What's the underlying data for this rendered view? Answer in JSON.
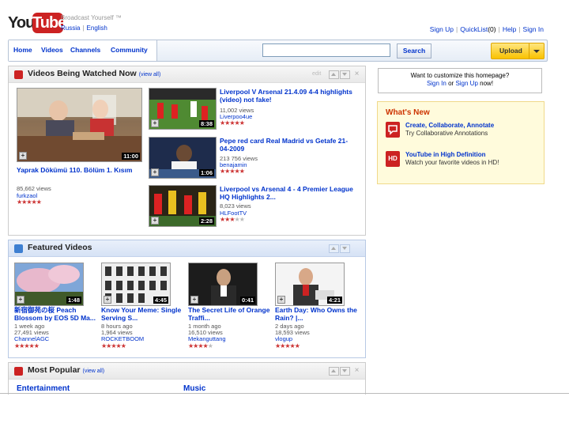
{
  "header": {
    "logo_you": "You",
    "logo_tube": "Tube",
    "tagline": "Broadcast Yourself ™",
    "region": "Russia",
    "language": "English",
    "links": [
      "Sign Up",
      "QuickList",
      "(0)",
      "Help",
      "Sign In"
    ]
  },
  "nav": {
    "tabs": [
      "Home",
      "Videos",
      "Channels",
      "Community"
    ],
    "search_value": "",
    "search_button": "Search",
    "upload_button": "Upload"
  },
  "watched": {
    "title": "Videos Being Watched Now",
    "view_all": "(view all)",
    "edit": "edit",
    "main": {
      "title": "Yaprak Dökümü 110. Bölüm 1. Kısım",
      "duration": "11:00",
      "views": "85,662 views",
      "user": "furkzaol",
      "rating": 5
    },
    "items": [
      {
        "title": "Liverpool V Arsenal 21.4.09 4-4 highlights (video) not fake!",
        "duration": "8:38",
        "views": "11,002 views",
        "user": "Liverpoo4ue",
        "rating": 4.5
      },
      {
        "title": "Pepe red card Real Madrid vs Getafe 21-04-2009",
        "duration": "1:06",
        "views": "213 756 views",
        "user": "benajamin",
        "rating": 4.5
      },
      {
        "title": "Liverpool vs Arsenal 4 - 4 Premier League HQ Highlights 2...",
        "duration": "2:28",
        "views": "8,023 views",
        "user": "HLFootTV",
        "rating": 3
      }
    ]
  },
  "featured": {
    "title": "Featured Videos",
    "items": [
      {
        "title": "新宿御苑の桜 Peach Blossom by EOS 5D Ma...",
        "duration": "1:48",
        "time": "1 week ago",
        "views": "27,491 views",
        "user": "ChannelAGC",
        "rating": 4.5
      },
      {
        "title": "Know Your Meme: Single Serving S...",
        "duration": "4:45",
        "time": "8 hours ago",
        "views": "1,964 views",
        "user": "ROCKETBOOM",
        "rating": 4.5
      },
      {
        "title": "The Secret Life of Orange Traffi...",
        "duration": "0:41",
        "time": "1 month ago",
        "views": "16,510 views",
        "user": "Mekanguttang",
        "rating": 3.5
      },
      {
        "title": "Earth Day: Who Owns the Rain? |...",
        "duration": "4:21",
        "time": "2 days ago",
        "views": "18,593 views",
        "user": "vlogup",
        "rating": 4.5
      }
    ]
  },
  "popular": {
    "title": "Most Popular",
    "view_all": "(view all)",
    "categories": [
      "Entertainment",
      "Music"
    ]
  },
  "customize": {
    "line1": "Want to customize this homepage?",
    "sign_in": "Sign In",
    "or": "or",
    "sign_up": "Sign Up",
    "now": "now!"
  },
  "whats_new": {
    "title": "What's New",
    "items": [
      {
        "icon_label": "",
        "link": "Create, Collaborate, Annotate",
        "desc": "Try Collaborative Annotations"
      },
      {
        "icon_label": "HD",
        "link": "YouTube in High Definition",
        "desc": "Watch your favorite videos in HD!"
      }
    ]
  },
  "colors": {
    "link": "#0033cc",
    "logo_red": "#cc2222",
    "star_red": "#cc3333",
    "upload_yellow": "#f9c200",
    "whats_new_bg": "#fffbdc"
  }
}
